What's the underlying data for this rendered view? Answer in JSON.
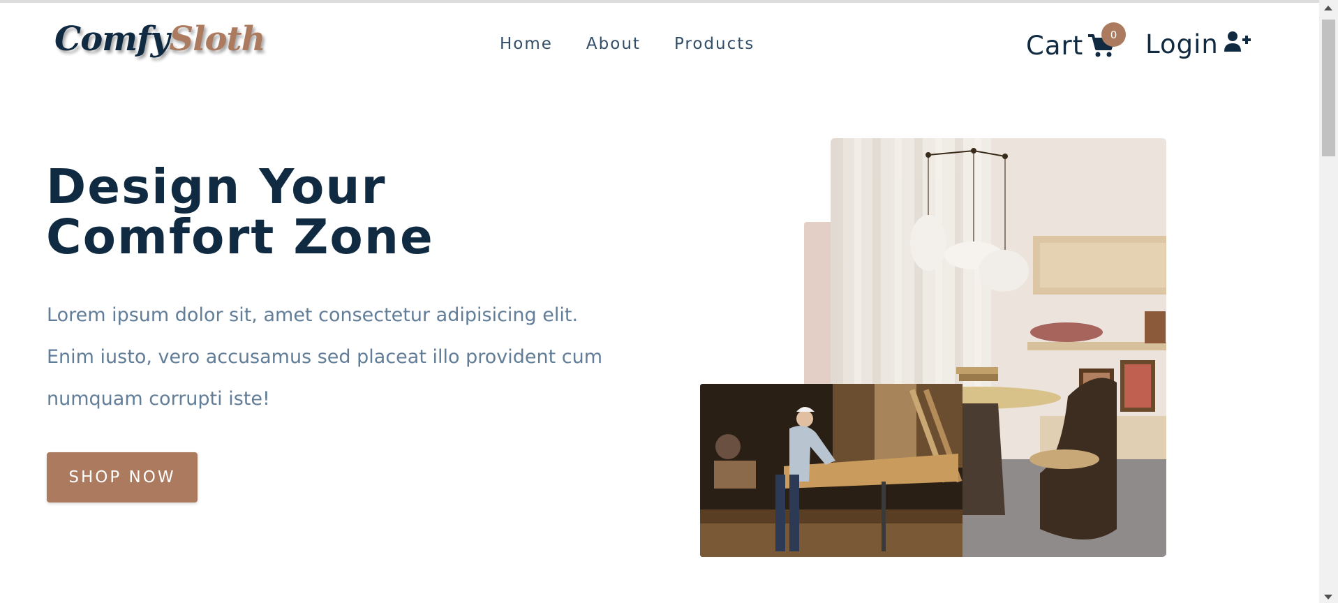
{
  "navbar": {
    "logo_part1": "Comfy",
    "logo_part2": "Sloth",
    "links": [
      "Home",
      "About",
      "Products"
    ],
    "cart_label": "Cart",
    "cart_count": "0",
    "login_label": "Login"
  },
  "hero": {
    "title_line1": "Design Your",
    "title_line2": "Comfort Zone",
    "text_line1": "Lorem ipsum dolor sit, amet consectetur adipisicing elit.",
    "text_line2": "Enim iusto, vero accusamus sed placeat illo provident cum",
    "text_line3": "numquam corrupti iste!",
    "cta_label": "SHOP NOW"
  },
  "colors": {
    "brand": "#ab7a5f",
    "heading": "#102a42",
    "body_text": "#617d98",
    "accent_block": "#e3cfc5"
  },
  "icons": {
    "cart": "cart-icon",
    "login": "user-plus-icon"
  }
}
